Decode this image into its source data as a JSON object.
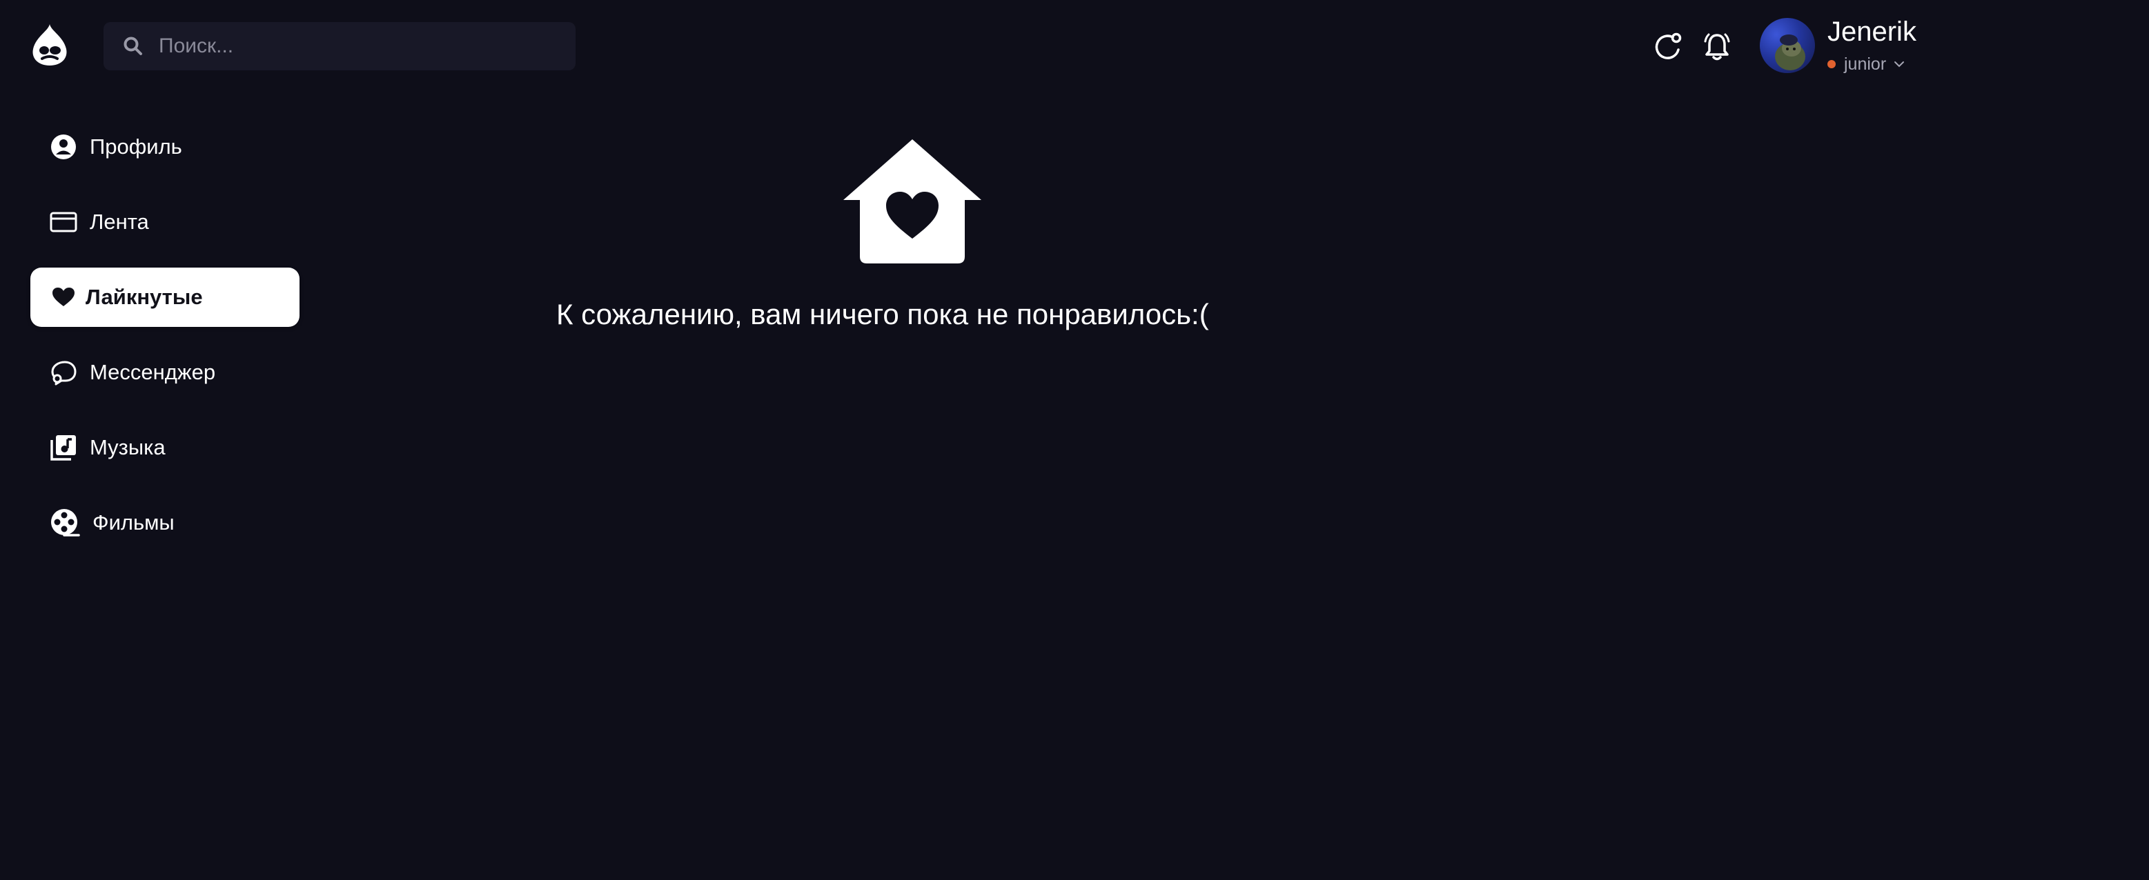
{
  "search": {
    "placeholder": "Поиск..."
  },
  "header": {
    "icons": [
      "refresh-icon",
      "bell-icon"
    ],
    "user": {
      "name": "Jenerik",
      "role": "junior",
      "status_color": "#e2622f"
    }
  },
  "sidebar": {
    "items": [
      {
        "label": "Профиль",
        "icon": "user-circle-icon",
        "active": false
      },
      {
        "label": "Лента",
        "icon": "feed-card-icon",
        "active": false
      },
      {
        "label": "Лайкнутые",
        "icon": "heart-icon",
        "active": true
      },
      {
        "label": "Мессенджер",
        "icon": "chat-bubble-icon",
        "active": false
      },
      {
        "label": "Музыка",
        "icon": "music-library-icon",
        "active": false
      },
      {
        "label": "Фильмы",
        "icon": "film-reel-icon",
        "active": false
      }
    ]
  },
  "main": {
    "empty_icon": "house-heart-icon",
    "empty_message": "К сожалению, вам ничего пока не понравилось:("
  },
  "colors": {
    "background": "#0e0e19",
    "search_bg": "#181827",
    "active_item_bg": "#ffffff",
    "text": "#ffffff"
  }
}
